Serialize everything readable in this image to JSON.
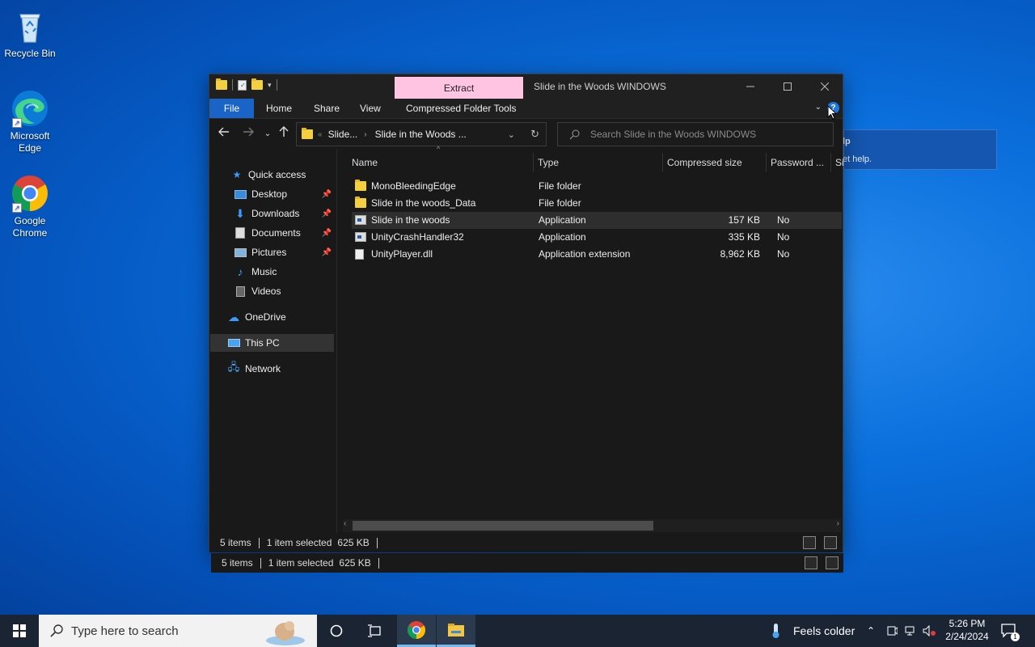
{
  "desktop": {
    "icons": [
      {
        "label": "Recycle Bin"
      },
      {
        "label": "Microsoft Edge"
      },
      {
        "label": "Google Chrome"
      }
    ]
  },
  "window": {
    "title": "Slide in the Woods WINDOWS",
    "context_tab": "Extract",
    "ribbon_tabs": [
      "File",
      "Home",
      "Share",
      "View",
      "Compressed Folder Tools"
    ],
    "help_glyph": "?",
    "address": {
      "crumbs": [
        "Slide...",
        "Slide in the Woods ..."
      ]
    },
    "search_placeholder": "Search Slide in the Woods WINDOWS",
    "nav": {
      "quick_access": "Quick access",
      "items": [
        {
          "label": "Desktop",
          "pinned": true
        },
        {
          "label": "Downloads",
          "pinned": true
        },
        {
          "label": "Documents",
          "pinned": true
        },
        {
          "label": "Pictures",
          "pinned": true
        },
        {
          "label": "Music",
          "pinned": false
        },
        {
          "label": "Videos",
          "pinned": false
        }
      ],
      "onedrive": "OneDrive",
      "this_pc": "This PC",
      "network": "Network"
    },
    "columns": [
      "Name",
      "Type",
      "Compressed size",
      "Password ...",
      "Si"
    ],
    "files": [
      {
        "name": "MonoBleedingEdge",
        "type": "File folder",
        "size": "",
        "password": "",
        "icon": "folder-icon"
      },
      {
        "name": "Slide in the woods_Data",
        "type": "File folder",
        "size": "",
        "password": "",
        "icon": "folder-icon"
      },
      {
        "name": "Slide in the woods",
        "type": "Application",
        "size": "157 KB",
        "password": "No",
        "icon": "app-icon",
        "selected": true
      },
      {
        "name": "UnityCrashHandler32",
        "type": "Application",
        "size": "335 KB",
        "password": "No",
        "icon": "app-icon"
      },
      {
        "name": "UnityPlayer.dll",
        "type": "Application extension",
        "size": "8,962 KB",
        "password": "No",
        "icon": "dll-icon"
      }
    ],
    "status": {
      "items": "5 items",
      "selected": "1 item selected",
      "size": "625 KB"
    }
  },
  "tooltip": {
    "line1": "lp",
    "line2": "et help."
  },
  "taskbar": {
    "search_placeholder": "Type here to search",
    "weather": "Feels colder",
    "time": "5:26 PM",
    "date": "2/24/2024",
    "notification_count": "1"
  },
  "colors": {
    "accent": "#1a63c7",
    "context_tab": "#ffc4e1",
    "window_bg": "#191919"
  }
}
